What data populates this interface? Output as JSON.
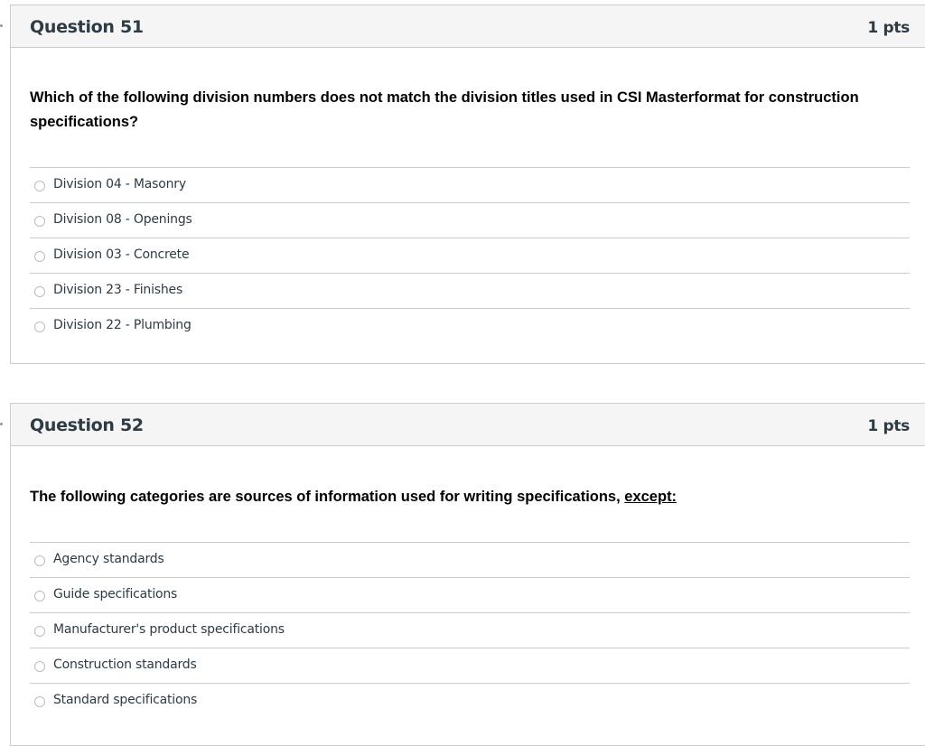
{
  "questions": [
    {
      "title": "Question 51",
      "points": "1 pts",
      "text": "Which of the following division numbers does not match the division titles used in CSI Masterformat for construction specifications?",
      "answers": [
        "Division 04 - Masonry",
        "Division 08 - Openings",
        "Division 03 - Concrete",
        "Division 23 - Finishes",
        "Division 22 - Plumbing"
      ]
    },
    {
      "title": "Question 52",
      "points": "1 pts",
      "text_main": "The following categories are sources of information used for writing specifications, ",
      "text_emphasis": "except:",
      "answers": [
        "Agency standards",
        "Guide specifications",
        "Manufacturer's product specifications",
        "Construction standards",
        "Standard specifications"
      ]
    }
  ]
}
